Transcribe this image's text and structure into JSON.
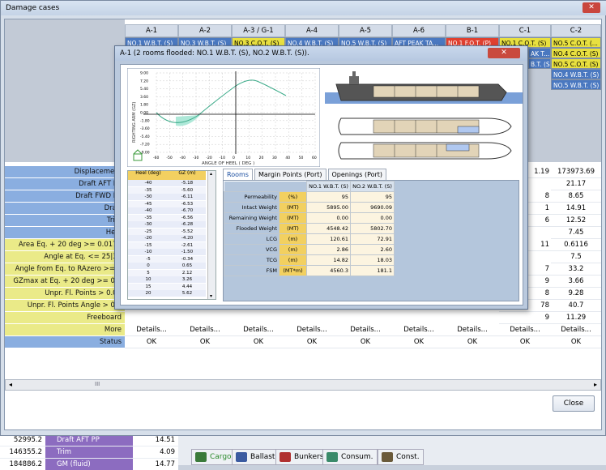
{
  "background": {
    "rows": [
      {
        "num": "52995.2",
        "label": "Draft AFT PP",
        "value": "14.51"
      },
      {
        "num": "146355.2",
        "label": "Trim",
        "value": "4.09"
      },
      {
        "num": "184886.2",
        "label": "GM (fluid)",
        "value": "14.77"
      }
    ],
    "toolbar": [
      "Cargo",
      "Ballast",
      "Bunkers",
      "Consum.",
      "Const."
    ]
  },
  "window": {
    "title": "Damage cases",
    "close_symbol": "✕",
    "columns": [
      "A-1",
      "A-2",
      "A-3 / G-1",
      "A-4",
      "A-5",
      "A-6",
      "B-1",
      "C-1",
      "C-2"
    ],
    "rooms_row": [
      "NO.1 W.B.T. (S)",
      "NO.3 W.B.T. (S)",
      "NO.3 C.O.T. (S)",
      "NO.4 W.B.T. (S)",
      "NO.5 W.B.T. (S)",
      "AFT PEAK TA...",
      "NO.1 F.O.T. (P)",
      "NO.1 C.O.T. (S)",
      "NO.5 C.O.T. (..."
    ],
    "c1_rooms": [
      "AK T...",
      "B.T. (S)"
    ],
    "c2_rooms": [
      "NO.4 C.O.T. (S)",
      "NO.5 C.O.T. (S)",
      "NO.4 W.B.T. (S)",
      "NO.5 W.B.T. (S)"
    ],
    "row_labels": [
      "Displacement",
      "Draft AFT PP",
      "Draft FWD PP",
      "Draft",
      "Trim",
      "Heel",
      "Area Eq. + 20 deg >= 0.0175",
      "Angle at Eq. <= 25|30",
      "Angle from Eq. to RAzero >= 2",
      "GZmax at Eq. + 20 deg >= 0.1",
      "Unpr. Fl. Points > 0.00",
      "Unpr. Fl. Points Angle > 0.0",
      "Freeboard",
      "More",
      "Status"
    ],
    "c1_values": [
      "1.19",
      "8",
      "1",
      "6",
      "11",
      "7",
      "9",
      "8",
      "78",
      "9"
    ],
    "c2_values": [
      "173973.69",
      "21.17",
      "8.65",
      "14.91",
      "12.52",
      "7.45",
      "0.6116",
      "7.5",
      "33.2",
      "3.66",
      "9.28",
      "40.7",
      "11.29"
    ],
    "details_label": "Details...",
    "status_ok": "OK",
    "scroll_mid": "III",
    "close_button": "Close"
  },
  "dialog": {
    "title": "A-1 (2 rooms flooded: NO.1 W.B.T. (S), NO.2 W.B.T. (S)).",
    "close_symbol": "✕",
    "chart": {
      "ylabel": "RIGHTING ARM (GZ)",
      "xlabel": "ANGLE OF HEEL ( DEG )",
      "yticks": [
        "9.00",
        "7.20",
        "5.40",
        "3.60",
        "1.80",
        "0.00",
        "-1.80",
        "-3.60",
        "-5.40",
        "-7.20",
        "-9.00"
      ],
      "xticks": [
        "-60",
        "-50",
        "-40",
        "-30",
        "-20",
        "-10",
        "0",
        "10",
        "20",
        "30",
        "40",
        "50",
        "60"
      ]
    },
    "tabs": [
      "Rooms",
      "Margin Points (Port)",
      "Openings (Port)"
    ],
    "heel_table": {
      "headers": [
        "Heel (deg)",
        "GZ (m)"
      ],
      "rows": [
        [
          "-40",
          "-5.18"
        ],
        [
          "-35",
          "-5.60"
        ],
        [
          "-30",
          "-6.11"
        ],
        [
          "-45",
          "-6.53"
        ],
        [
          "-40",
          "-6.70"
        ],
        [
          "-35",
          "-6.56"
        ],
        [
          "-30",
          "-6.28"
        ],
        [
          "-25",
          "-5.52"
        ],
        [
          "-20",
          "-4.20"
        ],
        [
          "-15",
          "-2.61"
        ],
        [
          "-10",
          "-1.50"
        ],
        [
          "-5",
          "-0.34"
        ],
        [
          "0",
          "0.65"
        ],
        [
          "5",
          "2.12"
        ],
        [
          "10",
          "3.26"
        ],
        [
          "15",
          "4.44"
        ],
        [
          "20",
          "5.62"
        ]
      ]
    },
    "room_table": {
      "cols": [
        "NO.1 W.B.T. (S)",
        "NO.2 W.B.T. (S)"
      ],
      "rows": [
        {
          "label": "Permeability",
          "unit": "(%)",
          "v1": "95",
          "v2": "95"
        },
        {
          "label": "Intact Weight",
          "unit": "(MT)",
          "v1": "5895.00",
          "v2": "9690.09"
        },
        {
          "label": "Remaining Weight",
          "unit": "(MT)",
          "v1": "0.00",
          "v2": "0.00"
        },
        {
          "label": "Flooded Weight",
          "unit": "(MT)",
          "v1": "4548.42",
          "v2": "5802.70"
        },
        {
          "label": "LCG",
          "unit": "(m)",
          "v1": "120.61",
          "v2": "72.91"
        },
        {
          "label": "VCG",
          "unit": "(m)",
          "v1": "2.86",
          "v2": "2.60"
        },
        {
          "label": "TCG",
          "unit": "(m)",
          "v1": "14.82",
          "v2": "18.03"
        },
        {
          "label": "FSM",
          "unit": "(MT*m)",
          "v1": "4560.3",
          "v2": "181.1"
        }
      ]
    }
  }
}
